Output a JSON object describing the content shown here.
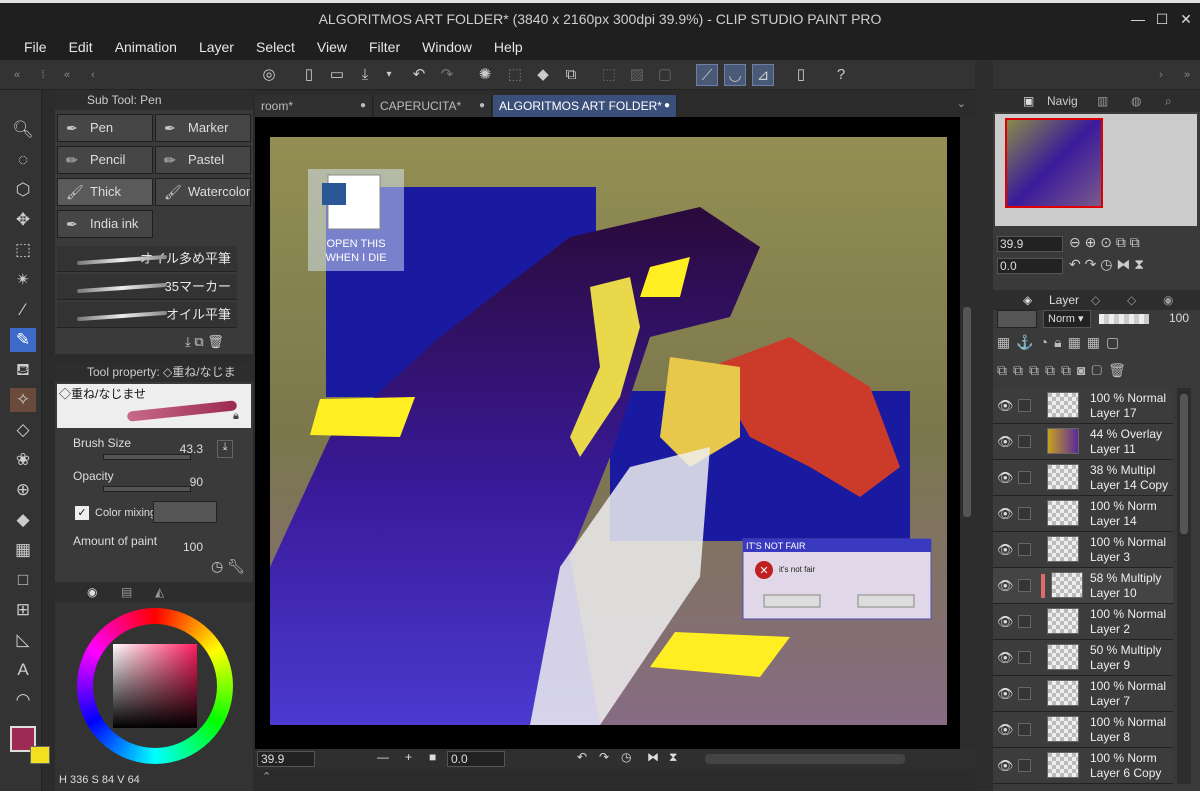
{
  "window": {
    "title": "ALGORITMOS ART FOLDER* (3840 x 2160px 300dpi 39.9%)  - CLIP STUDIO PAINT PRO"
  },
  "menu": [
    "File",
    "Edit",
    "Animation",
    "Layer",
    "Select",
    "View",
    "Filter",
    "Window",
    "Help"
  ],
  "subtool": {
    "header": "Sub Tool: Pen",
    "buttons": [
      "Pen",
      "Marker",
      "Pencil",
      "Pastel",
      "Thick paint",
      "Watercolor",
      "India ink"
    ],
    "selected": "Thick paint",
    "brushes": [
      "オイル多め平筆",
      "35マーカー",
      "オイル平筆"
    ]
  },
  "tool_property": {
    "header": "Tool property: ◇重ね/なじま",
    "preview_label": "◇重ね/なじませ",
    "brush_size_label": "Brush Size",
    "brush_size": "43.3",
    "opacity_label": "Opacity",
    "opacity": "90",
    "color_mixing_label": "Color mixing",
    "amount_label": "Amount of paint",
    "amount": "100"
  },
  "color": {
    "main": "#9c2a52",
    "sub": "#f0e020",
    "readout": {
      "h_label": "H",
      "h": "336",
      "s_label": "S",
      "s": "84",
      "v_label": "V",
      "v": "64"
    }
  },
  "tabs": [
    {
      "label": "room*"
    },
    {
      "label": "CAPERUCITA*"
    },
    {
      "label": "ALGORITMOS ART FOLDER*"
    }
  ],
  "canvas": {
    "desktop_icon_label": "OPEN THIS WHEN I DIE",
    "dialog_title": "IT'S NOT FAIR",
    "dialog_message": "it's not fair"
  },
  "statusbar": {
    "zoom": "39.9",
    "angle": "0.0"
  },
  "navigator": {
    "tab_label": "Navig",
    "zoom": "39.9",
    "angle": "0.0"
  },
  "layers": {
    "tab_label": "Layer",
    "blend_mode": "Norm",
    "opacity": "100",
    "items": [
      {
        "blend": "100 % Normal",
        "name": "Layer 17"
      },
      {
        "blend": "44 % Overlay",
        "name": "Layer 11"
      },
      {
        "blend": "38 % Multipl",
        "name": "Layer 14 Copy"
      },
      {
        "blend": "100 % Norm",
        "name": "Layer 14"
      },
      {
        "blend": "100 % Normal",
        "name": "Layer 3"
      },
      {
        "blend": "58 % Multiply",
        "name": "Layer 10"
      },
      {
        "blend": "100 % Normal",
        "name": "Layer 2"
      },
      {
        "blend": "50 % Multiply",
        "name": "Layer 9"
      },
      {
        "blend": "100 % Normal",
        "name": "Layer 7"
      },
      {
        "blend": "100 % Normal",
        "name": "Layer 8"
      },
      {
        "blend": "100 % Norm",
        "name": "Layer 6 Copy"
      }
    ]
  }
}
